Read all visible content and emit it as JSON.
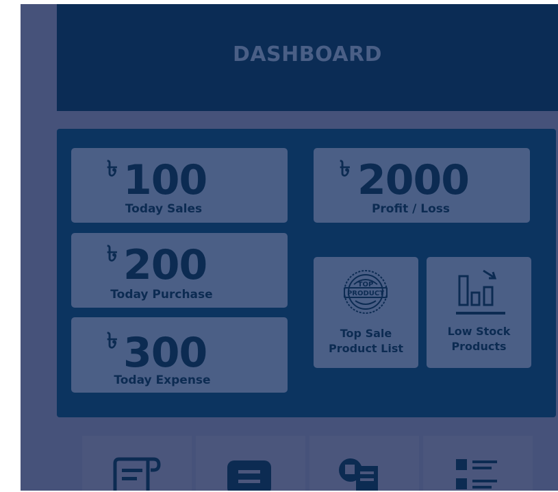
{
  "header": {
    "title": "DASHBOARD"
  },
  "currency_symbol": "৳",
  "cards": {
    "today_sales": {
      "amount": "100",
      "label": "Today Sales"
    },
    "today_purchase": {
      "amount": "200",
      "label": "Today Purchase"
    },
    "today_expense": {
      "amount": "300",
      "label": "Today Expense"
    },
    "profit_loss": {
      "amount": "2000",
      "label": "Profit / Loss"
    }
  },
  "tiles": {
    "top_sale": {
      "line1": "Top Sale",
      "line2": "Product List",
      "badge_top": "TOP",
      "badge_bottom": "PRODUCT"
    },
    "low_stock": {
      "line1": "Low Stock",
      "line2": "Products"
    }
  },
  "bottom_nav": {
    "items": [
      {
        "icon": "receipt-icon"
      },
      {
        "icon": "list-card-icon"
      },
      {
        "icon": "delivery-box-icon"
      },
      {
        "icon": "contact-list-icon"
      }
    ]
  },
  "colors": {
    "overlay": "#46527a",
    "header_bg": "#0b2c55",
    "panel_bg": "#0c3460",
    "card_bg": "#4b5f86",
    "card_text": "#0c2b52"
  }
}
